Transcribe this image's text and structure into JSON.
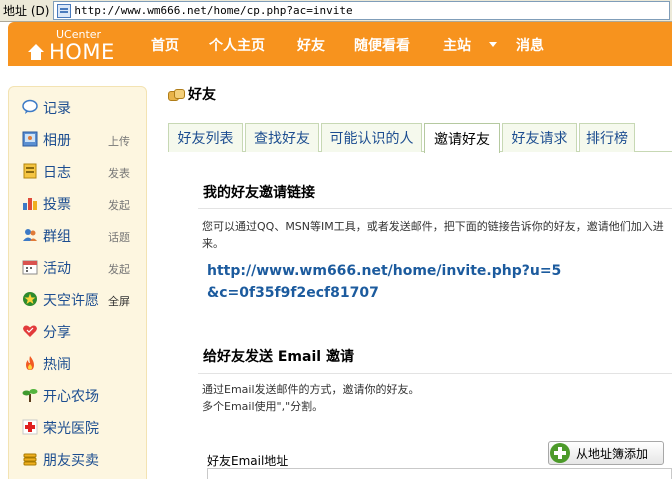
{
  "browser": {
    "address_label": "地址 (D)",
    "url": "http://www.wm666.net/home/cp.php?ac=invite"
  },
  "header": {
    "logo_small": "UCenter",
    "logo_big": "HOME",
    "nav": [
      "首页",
      "个人主页",
      "好友",
      "随便看看",
      "主站",
      "消息"
    ]
  },
  "sidebar": {
    "items": [
      {
        "label": "记录",
        "sub": ""
      },
      {
        "label": "相册",
        "sub": "上传"
      },
      {
        "label": "日志",
        "sub": "发表"
      },
      {
        "label": "投票",
        "sub": "发起"
      },
      {
        "label": "群组",
        "sub": "话题"
      },
      {
        "label": "活动",
        "sub": "发起"
      },
      {
        "label": "天空许愿",
        "sub": "全屏"
      },
      {
        "label": "分享",
        "sub": ""
      },
      {
        "label": "热闹",
        "sub": ""
      },
      {
        "label": "开心农场",
        "sub": ""
      },
      {
        "label": "荣光医院",
        "sub": ""
      },
      {
        "label": "朋友买卖",
        "sub": ""
      }
    ]
  },
  "main": {
    "page_title": "好友",
    "tabs": [
      "好友列表",
      "查找好友",
      "可能认识的人",
      "邀请好友",
      "好友请求",
      "排行榜"
    ],
    "active_tab": "邀请好友",
    "link_section": {
      "title": "我的好友邀请链接",
      "desc": "您可以通过QQ、MSN等IM工具，或者发送邮件，把下面的链接告诉你的好友，邀请他们加入进来。",
      "link": "http://www.wm666.net/home/invite.php?u=5&c=0f35f9f2ecf81707"
    },
    "email_section": {
      "title": "给好友发送 Email 邀请",
      "desc_line1": "通过Email发送邮件的方式，邀请你的好友。",
      "desc_line2": "多个Email使用\",\"分割。",
      "field_label": "好友Email地址",
      "address_book_button": "从地址簿添加"
    }
  },
  "colors": {
    "header_orange": "#f7931e",
    "link_blue": "#1c5b9e",
    "sidebar_bg": "#fdf6e0"
  }
}
